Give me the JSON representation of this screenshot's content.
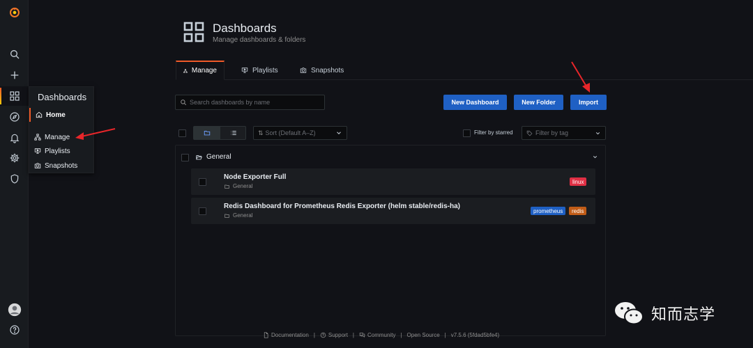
{
  "page": {
    "title": "Dashboards",
    "subtitle": "Manage dashboards & folders"
  },
  "sidebar": {
    "icons": [
      "grafana-logo-icon",
      "search-icon",
      "plus-icon",
      "dashboards-icon",
      "explore-icon",
      "alerting-bell-icon",
      "configuration-gear-icon",
      "server-admin-shield-icon",
      "user-avatar-icon",
      "help-icon"
    ]
  },
  "flyout": {
    "title": "Dashboards",
    "home": "Home",
    "items": [
      "Manage",
      "Playlists",
      "Snapshots"
    ]
  },
  "tabs": [
    {
      "label": "Manage",
      "active": true
    },
    {
      "label": "Playlists",
      "active": false
    },
    {
      "label": "Snapshots",
      "active": false
    }
  ],
  "search": {
    "placeholder": "Search dashboards by name"
  },
  "buttons": {
    "new_dashboard": "New Dashboard",
    "new_folder": "New Folder",
    "import": "Import"
  },
  "filters": {
    "sort_placeholder": "Sort (Default A–Z)",
    "starred_label": "Filter by starred",
    "tag_placeholder": "Filter by tag"
  },
  "folder": {
    "name": "General"
  },
  "dashboards": [
    {
      "title": "Node Exporter Full",
      "folder": "General",
      "tags": [
        {
          "label": "linux",
          "color": "#e02f44"
        }
      ]
    },
    {
      "title": "Redis Dashboard for Prometheus Redis Exporter (helm stable/redis-ha)",
      "folder": "General",
      "tags": [
        {
          "label": "prometheus",
          "color": "#1f60c4"
        },
        {
          "label": "redis",
          "color": "#c15c17"
        }
      ]
    }
  ],
  "footer": {
    "documentation": "Documentation",
    "support": "Support",
    "community": "Community",
    "open_source": "Open Source",
    "version": "v7.5.6 (5fdad5bfe4)"
  },
  "watermark": {
    "text": "知而志学"
  },
  "colors": {
    "accent": "#f05a28",
    "primary_button": "#1f60c4",
    "annotation_arrow": "#e8262a"
  }
}
